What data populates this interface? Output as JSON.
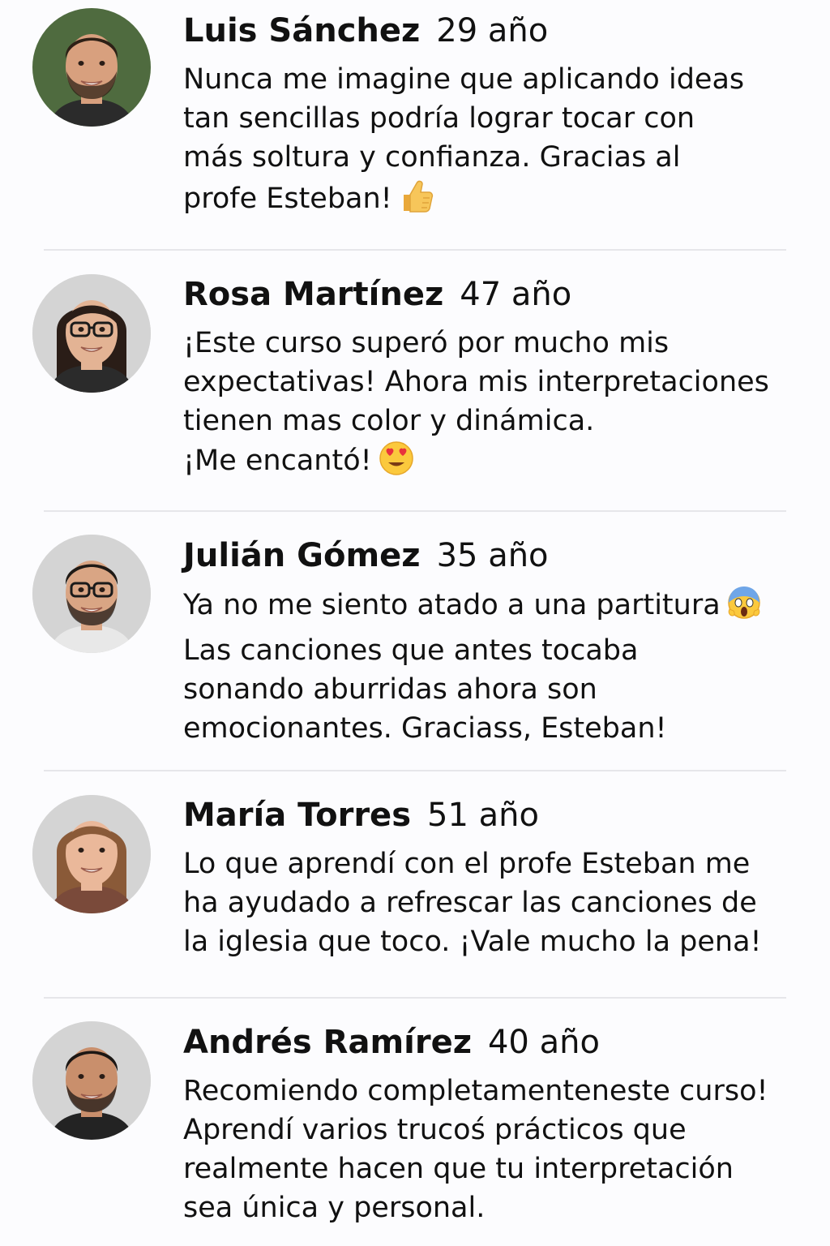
{
  "testimonials": [
    {
      "name": "Luis Sánchez",
      "age": "29 año",
      "lines": [
        "Nunca me imagine que aplicando ideas",
        "tan sencillas podría lograr tocar con",
        "más soltura y confianza. Gracias al",
        "profe Esteban!"
      ],
      "emoji": "thumbs-up-emoji",
      "avatar": {
        "skin": "#d8a07e",
        "hair": "#2d2016",
        "shirt": "#2b2b2b",
        "bg": "#4f6b3f",
        "glasses": false,
        "beard": true
      }
    },
    {
      "name": "Rosa Martínez",
      "age": "47 año",
      "lines": [
        "¡Este curso superó por mucho mis",
        "expectativas! Ahora mis interpretaciones",
        "tienen mas color y dinámica.",
        "¡Me encantó!"
      ],
      "emoji": "heart-eyes-emoji",
      "avatar": {
        "skin": "#e3b394",
        "hair": "#2a1d17",
        "shirt": "#2b2b2b",
        "bg": "#d4d4d4",
        "glasses": true,
        "beard": false
      }
    },
    {
      "name": "Julián Gómez",
      "age": "35 año",
      "lines": [
        "Ya no me siento atado a una partitura",
        "Las canciones que antes tocaba",
        "sonando aburridas ahora son",
        "emocionantes. Graciass, Esteban!"
      ],
      "emoji": "screaming-face-emoji",
      "avatar": {
        "skin": "#d9a584",
        "hair": "#1f1a16",
        "shirt": "#e8e8e8",
        "bg": "#d4d4d4",
        "glasses": true,
        "beard": true
      }
    },
    {
      "name": "María Torres",
      "age": "51 año",
      "lines": [
        "Lo que aprendí con el profe Esteban me",
        "ha ayudado a refrescar las canciones de",
        "la iglesia que toco. ¡Vale mucho la pena!"
      ],
      "emoji": "",
      "avatar": {
        "skin": "#eab89a",
        "hair": "#8a5a38",
        "shirt": "#7a4a3a",
        "bg": "#d4d4d4",
        "glasses": false,
        "beard": false
      }
    },
    {
      "name": "Andrés Ramírez",
      "age": "40 año",
      "lines": [
        "Recomiendo completamenteneste curso!",
        "Aprendí varios trucoś prácticos que",
        "realmente hacen que tu interpretación",
        "sea única y personal."
      ],
      "emoji": "",
      "avatar": {
        "skin": "#c98f6c",
        "hair": "#1c1714",
        "shirt": "#232323",
        "bg": "#d4d4d4",
        "glasses": false,
        "beard": true
      }
    }
  ]
}
